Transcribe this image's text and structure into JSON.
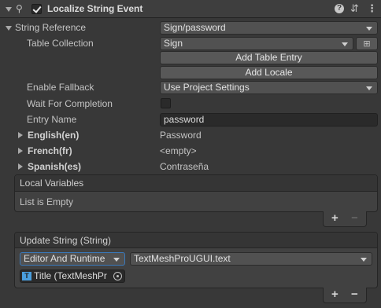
{
  "header": {
    "title": "Localize String Event",
    "enabled": true,
    "icons": [
      "script-icon",
      "help-icon",
      "preset-icon",
      "more-menu-icon"
    ]
  },
  "string_reference": {
    "label": "String Reference",
    "value": "Sign/password",
    "table_collection_label": "Table Collection",
    "table_collection_value": "Sign",
    "add_table_entry": "Add Table Entry",
    "add_locale": "Add Locale",
    "enable_fallback_label": "Enable Fallback",
    "enable_fallback_value": "Use Project Settings",
    "wait_label": "Wait For Completion",
    "wait_checked": false,
    "entry_name_label": "Entry Name",
    "entry_name_value": "password"
  },
  "locales": [
    {
      "label": "English(en)",
      "value": "Password"
    },
    {
      "label": "French(fr)",
      "value": "<empty>"
    },
    {
      "label": "Spanish(es)",
      "value": "Contraseña"
    }
  ],
  "local_variables": {
    "header": "Local Variables",
    "empty_text": "List is Empty",
    "add": "+",
    "remove": "−"
  },
  "update_string": {
    "header": "Update String (String)",
    "runtime_mode": "Editor And Runtime",
    "function": "TextMeshProUGUI.text",
    "target": "Title (TextMeshPr",
    "add": "+",
    "remove": "−"
  },
  "colors": {
    "background": "#383838",
    "header": "#3e3e3e",
    "accent_focus": "#3a79bb",
    "object_icon": "#4a9ede"
  }
}
